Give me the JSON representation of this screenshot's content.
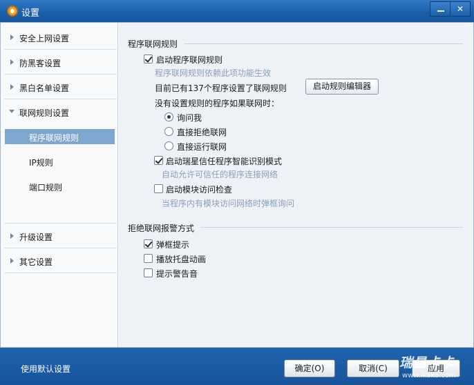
{
  "window": {
    "title": "设置"
  },
  "sidebar": {
    "items": [
      {
        "label": "安全上网设置"
      },
      {
        "label": "防黑客设置"
      },
      {
        "label": "黑白名单设置"
      },
      {
        "label": "联网规则设置",
        "expanded": true
      },
      {
        "label": "升级设置"
      },
      {
        "label": "其它设置"
      }
    ],
    "subitems": [
      {
        "label": "程序联网规则",
        "active": true
      },
      {
        "label": "IP规则"
      },
      {
        "label": "端口规则"
      }
    ]
  },
  "program_rules": {
    "section_title": "程序联网规则",
    "enable_rules": {
      "label": "启动程序联网规则",
      "checked": true
    },
    "enable_rules_hint": "程序联网规则依赖此项功能生效",
    "rule_count_text": "目前已有137个程序设置了联网规则",
    "editor_button": "启动规则编辑器",
    "no_rule_question": "没有设置规则的程序如果联网时：",
    "radio_options": [
      {
        "label": "询问我",
        "checked": true
      },
      {
        "label": "直接拒绝联网",
        "checked": false
      },
      {
        "label": "直接运行联网",
        "checked": false
      }
    ],
    "smart_mode": {
      "label": "启动瑞星信任程序智能识别模式",
      "checked": true
    },
    "smart_mode_hint": "自动允许可信任的程序连接网络",
    "module_check": {
      "label": "启动模块访问检查",
      "checked": false
    },
    "module_check_hint": "当程序内有模块访问网络时弹框询问"
  },
  "alert_section": {
    "section_title": "拒绝联网报警方式",
    "options": [
      {
        "label": "弹框提示",
        "checked": true
      },
      {
        "label": "播放托盘动画",
        "checked": false
      },
      {
        "label": "提示警告音",
        "checked": false
      }
    ]
  },
  "footer": {
    "default_settings": "使用默认设置",
    "ok_button": "确定(O)",
    "cancel_button": "取消(C)",
    "apply_button": "应用"
  },
  "watermark": {
    "brand": "瑞星卡卡",
    "url": "www.ikaka.com"
  }
}
